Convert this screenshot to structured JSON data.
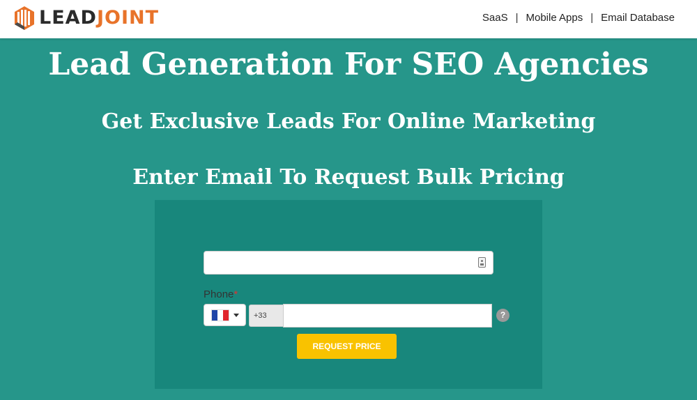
{
  "brand": {
    "name_part1": "LEAD",
    "name_part2": "JOINT",
    "icon": "leadjoint-logo-icon",
    "colors": {
      "dark": "#2b2b2b",
      "accent": "#e8732a"
    }
  },
  "nav": {
    "items": [
      {
        "label": "SaaS"
      },
      {
        "label": "Mobile Apps"
      },
      {
        "label": "Email Database"
      }
    ],
    "separator": "|"
  },
  "hero": {
    "title": "Lead Generation For SEO Agencies",
    "subtitle": "Get Exclusive Leads For Online Marketing",
    "cta_text": "Enter Email To Request Bulk Pricing"
  },
  "form": {
    "email": {
      "value": "",
      "placeholder": "",
      "icon": "autofill-contact-icon"
    },
    "phone": {
      "label": "Phone",
      "required_marker": "*",
      "country_flag": "flag-france-icon",
      "dial_code": "+33",
      "value": "",
      "help_icon": "question-mark-icon",
      "help_glyph": "?"
    },
    "submit_label": "REQUEST PRICE"
  },
  "colors": {
    "page_bg": "#26968a",
    "panel_bg": "#18877c",
    "button_bg": "#f9c200",
    "required": "#e03131"
  }
}
